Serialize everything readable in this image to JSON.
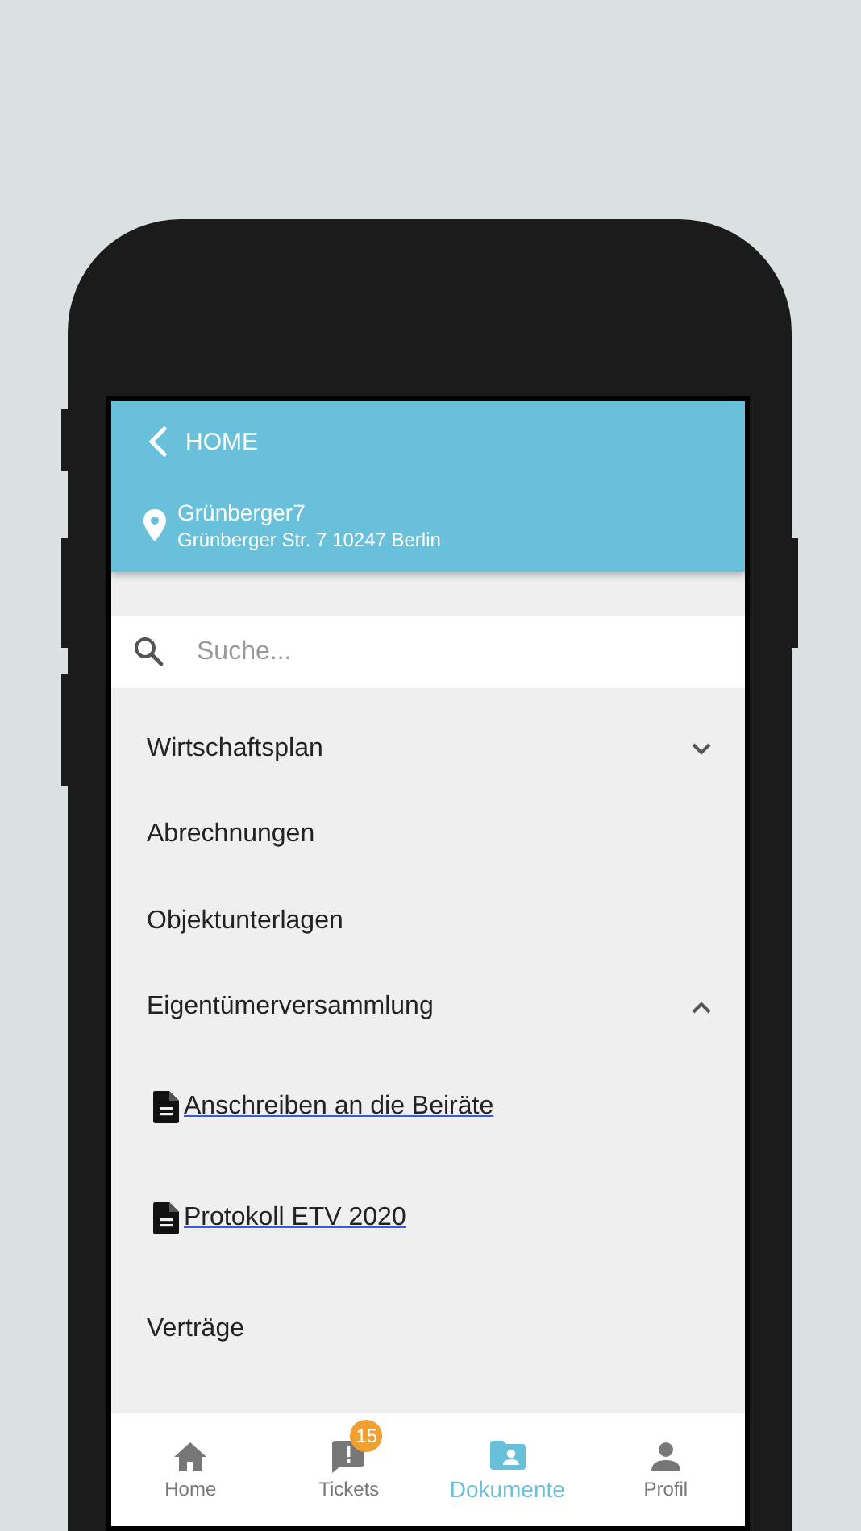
{
  "header": {
    "back_label": "HOME",
    "property_name": "Grünberger7",
    "address": "Grünberger Str. 7 10247 Berlin"
  },
  "search": {
    "placeholder": "Suche..."
  },
  "sections": [
    {
      "title": "Wirtschaftsplan",
      "kind": "collapsible",
      "expanded": false
    },
    {
      "title": "Abrechnungen",
      "kind": "plain"
    },
    {
      "title": "Objektunterlagen",
      "kind": "plain"
    },
    {
      "title": "Eigentümerversammlung",
      "kind": "collapsible",
      "expanded": true,
      "children": [
        {
          "title": "Anschreiben an die Beiräte"
        },
        {
          "title": "Protokoll ETV 2020"
        }
      ]
    },
    {
      "title": "Verträge",
      "kind": "plain"
    }
  ],
  "nav": [
    {
      "label": "Home",
      "selected": false
    },
    {
      "label": "Tickets",
      "selected": false,
      "badge": "15"
    },
    {
      "label": "Dokumente",
      "selected": true
    },
    {
      "label": "Profil",
      "selected": false
    }
  ]
}
